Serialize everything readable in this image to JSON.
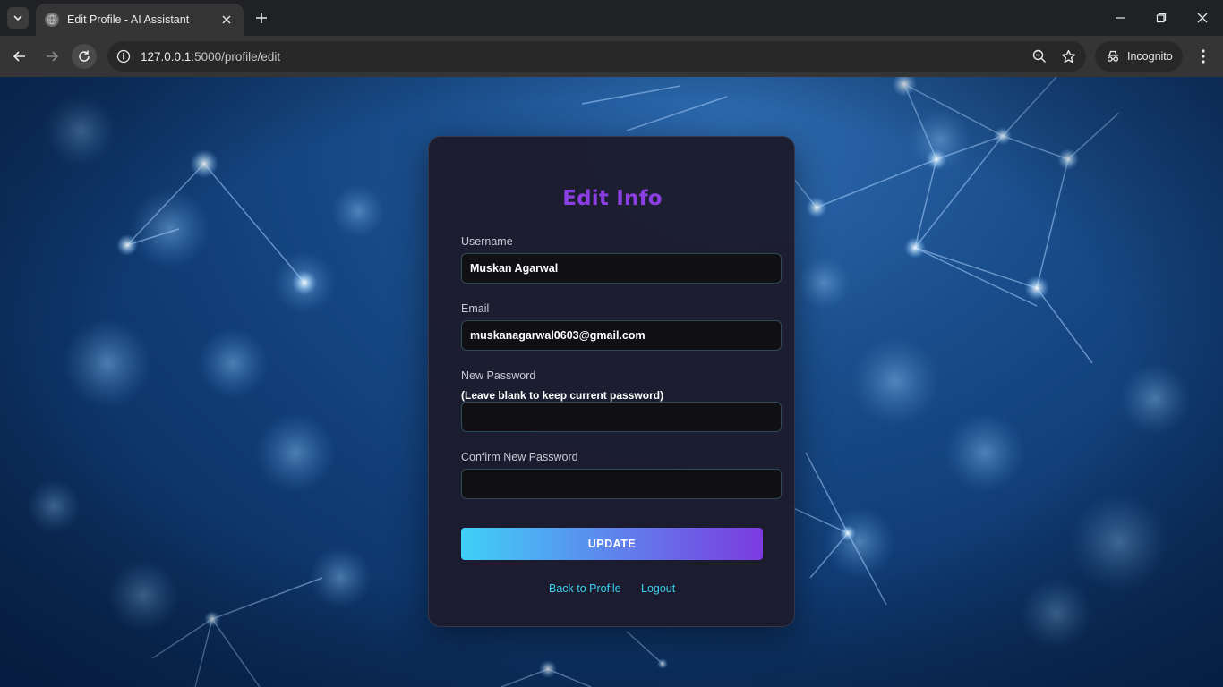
{
  "browser": {
    "tab_title": "Edit Profile - AI Assistant",
    "url_host": "127.0.0.1",
    "url_rest": ":5000/profile/edit",
    "incognito_label": "Incognito"
  },
  "form": {
    "title": "Edit Info",
    "username_label": "Username",
    "username_value": "Muskan Agarwal",
    "email_label": "Email",
    "email_value": "muskanagarwal0603@gmail.com",
    "new_password_label": "New Password",
    "new_password_hint": "(Leave blank to keep current password)",
    "new_password_value": "",
    "confirm_password_label": "Confirm New Password",
    "confirm_password_value": "",
    "update_label": "UPDATE",
    "back_link": "Back to Profile",
    "logout_link": "Logout"
  },
  "colors": {
    "title": "#8b3fe3",
    "link": "#3ccfeb",
    "button_start": "#3fd0f6",
    "button_end": "#7c3be0",
    "card": "#1c1b2d"
  }
}
